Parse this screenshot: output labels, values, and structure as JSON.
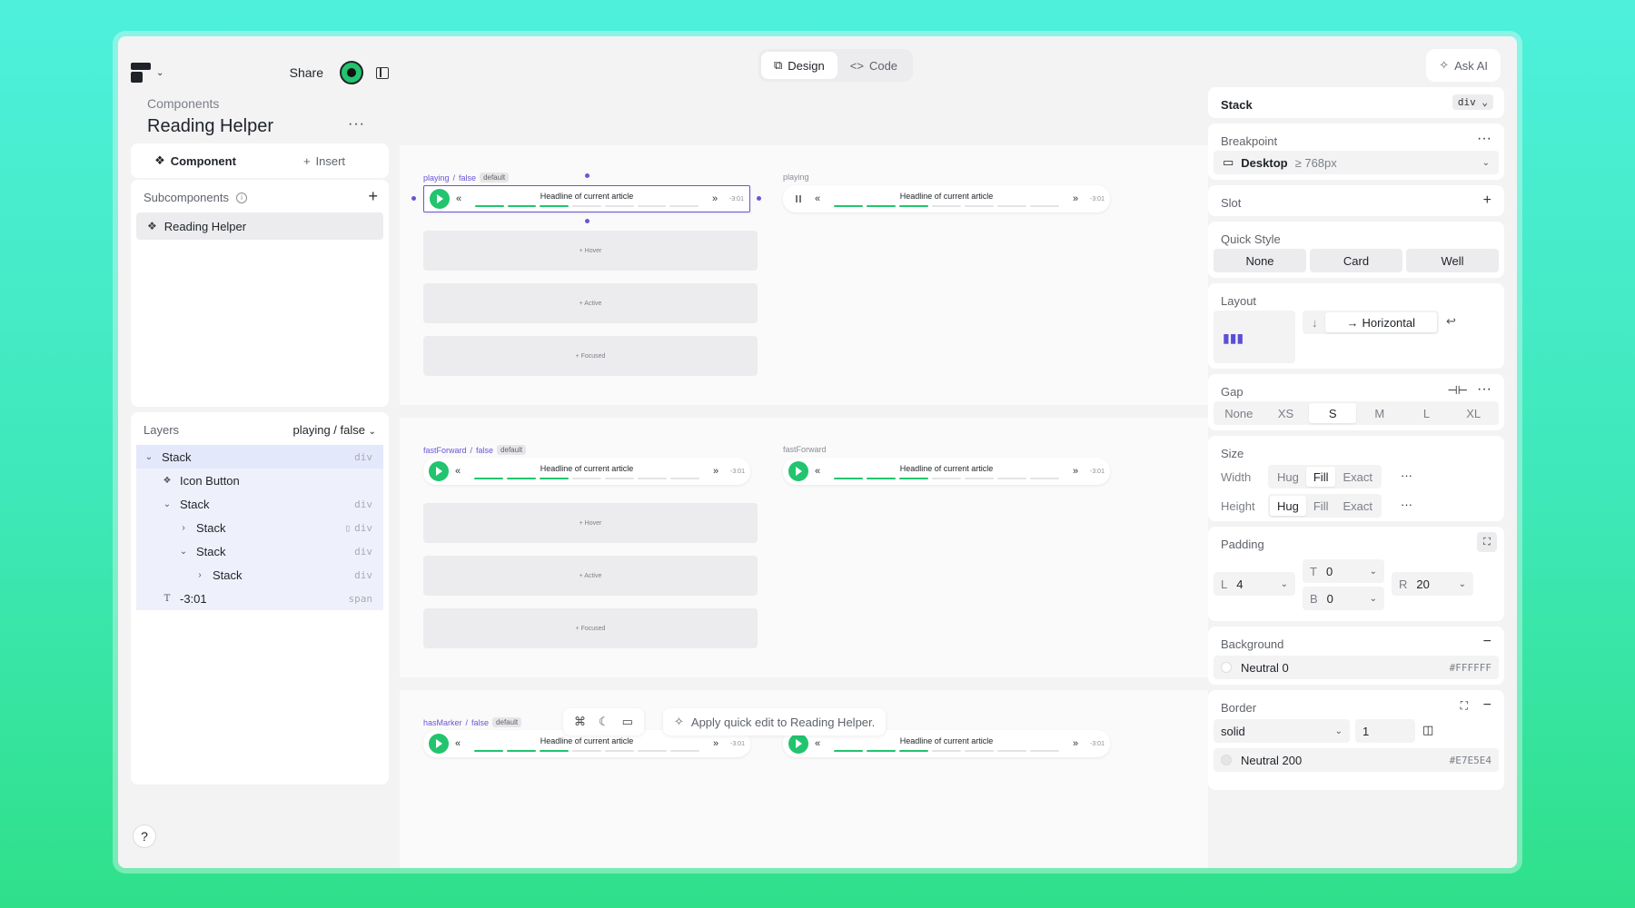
{
  "topbar": {
    "share": "Share"
  },
  "page": {
    "breadcrumb": "Components",
    "title": "Reading Helper",
    "more": "···"
  },
  "left_tabs": {
    "component": "Component",
    "insert": "Insert"
  },
  "subcomponents": {
    "heading": "Subcomponents",
    "items": [
      "Reading Helper"
    ]
  },
  "layers": {
    "heading": "Layers",
    "selector": "playing / false",
    "items": [
      {
        "label": "Stack",
        "tag": "div"
      },
      {
        "label": "Icon Button",
        "tag": ""
      },
      {
        "label": "Stack",
        "tag": "div"
      },
      {
        "label": "Stack",
        "tag": "div"
      },
      {
        "label": "Stack",
        "tag": "div"
      },
      {
        "label": "Stack",
        "tag": "div"
      },
      {
        "label": "-3:01",
        "tag": "span"
      }
    ]
  },
  "help": "?",
  "mode": {
    "design": "Design",
    "code": "Code"
  },
  "ask_ai": "Ask AI",
  "canvas": {
    "headline": "Headline of current article",
    "time": "-3:01",
    "default_badge": "default",
    "states": [
      "+ Hover",
      "+ Active",
      "+ Focused"
    ],
    "sections": [
      {
        "prop": "playing",
        "value": "false",
        "alt": "playing"
      },
      {
        "prop": "fastForward",
        "value": "false",
        "alt": "fastForward"
      },
      {
        "prop": "hasMarker",
        "value": "false",
        "alt": "hasMarker"
      }
    ]
  },
  "quick_edit": "Apply quick edit to Reading Helper.",
  "inspector": {
    "element": "Stack",
    "element_tag": "div",
    "breakpoint": {
      "heading": "Breakpoint",
      "value": "Desktop",
      "range": "≥ 768px"
    },
    "slot": "Slot",
    "quick_style": {
      "heading": "Quick Style",
      "options": [
        "None",
        "Card",
        "Well"
      ]
    },
    "layout": {
      "heading": "Layout",
      "direction": "Horizontal"
    },
    "gap": {
      "heading": "Gap",
      "options": [
        "None",
        "XS",
        "S",
        "M",
        "L",
        "XL"
      ],
      "selected": "S"
    },
    "size": {
      "heading": "Size",
      "width_label": "Width",
      "height_label": "Height",
      "options": [
        "Hug",
        "Fill",
        "Exact"
      ],
      "width_selected": "Fill",
      "height_selected": "Hug"
    },
    "padding": {
      "heading": "Padding",
      "L": "4",
      "T": "0",
      "B": "0",
      "R": "20"
    },
    "background": {
      "heading": "Background",
      "name": "Neutral 0",
      "hex": "#FFFFFF"
    },
    "border": {
      "heading": "Border",
      "style": "solid",
      "width": "1",
      "color_name": "Neutral 200",
      "hex": "#E7E5E4"
    }
  },
  "colors": {
    "accent": "#22c46e",
    "selection": "#6a55d8"
  }
}
